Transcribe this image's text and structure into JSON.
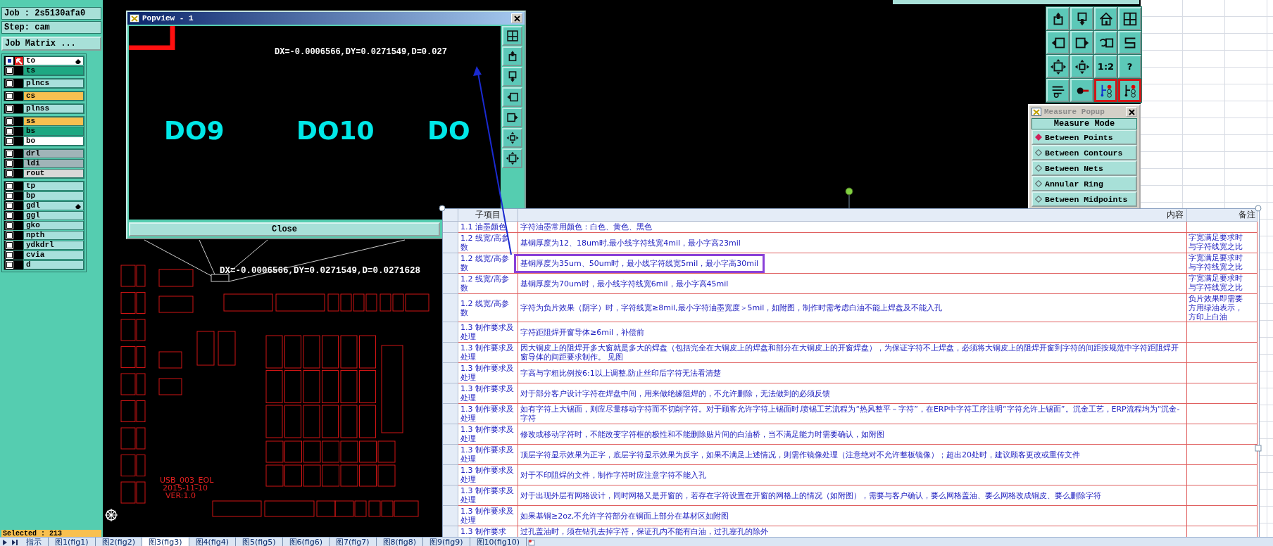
{
  "job_panel": {
    "job": "Job : 2s5130afa0",
    "step": "Step: cam",
    "matrix_button": "Job Matrix ...",
    "layer_groups": [
      {
        "layers": [
          {
            "name": "to",
            "color": "#ffffff",
            "checked": true,
            "work": true,
            "pointer": true
          },
          {
            "name": "ts",
            "color": "#1ea882",
            "checked": false,
            "work": false,
            "pointer": false
          }
        ]
      },
      {
        "layers": [
          {
            "name": "plncs",
            "color": "#a8e0dc",
            "checked": false,
            "work": false,
            "pointer": false
          }
        ]
      },
      {
        "layers": [
          {
            "name": "cs",
            "color": "#f8c050",
            "checked": false,
            "work": false,
            "pointer": false
          }
        ]
      },
      {
        "layers": [
          {
            "name": "plnss",
            "color": "#a8e0dc",
            "checked": false,
            "work": false,
            "pointer": false
          }
        ]
      },
      {
        "layers": [
          {
            "name": "ss",
            "color": "#f8c050",
            "checked": false,
            "work": false,
            "pointer": false
          },
          {
            "name": "bs",
            "color": "#1ea882",
            "checked": false,
            "work": false,
            "pointer": false
          },
          {
            "name": "bo",
            "color": "#ffffff",
            "checked": false,
            "work": false,
            "pointer": false
          }
        ]
      },
      {
        "layers": [
          {
            "name": "drl",
            "color": "#a0b4b8",
            "checked": false,
            "work": false,
            "pointer": false
          },
          {
            "name": "ldi",
            "color": "#a0b4b8",
            "checked": false,
            "work": false,
            "pointer": false
          },
          {
            "name": "rout",
            "color": "#d8d8d8",
            "checked": false,
            "work": false,
            "pointer": false
          }
        ]
      },
      {
        "layers": [
          {
            "name": "tp",
            "color": "#a8e0dc",
            "checked": false,
            "work": false,
            "pointer": false
          },
          {
            "name": "bp",
            "color": "#a8e0dc",
            "checked": false,
            "work": false,
            "pointer": false
          },
          {
            "name": "gdl",
            "color": "#a8e0dc",
            "checked": false,
            "work": false,
            "pointer": true
          },
          {
            "name": "ggl",
            "color": "#a8e0dc",
            "checked": false,
            "work": false,
            "pointer": false
          },
          {
            "name": "gko",
            "color": "#a8e0dc",
            "checked": false,
            "work": false,
            "pointer": false
          },
          {
            "name": "npth",
            "color": "#a8e0dc",
            "checked": false,
            "work": false,
            "pointer": false
          },
          {
            "name": "ydkdrl",
            "color": "#a8e0dc",
            "checked": false,
            "work": false,
            "pointer": false
          },
          {
            "name": "cvia",
            "color": "#a8e0dc",
            "checked": false,
            "work": false,
            "pointer": false
          },
          {
            "name": "d",
            "color": "#a8e0dc",
            "checked": false,
            "work": false,
            "pointer": false
          }
        ]
      }
    ],
    "selected_count": "Selected : 213"
  },
  "canvas": {
    "measurement": "DX=-0.0006566,DY=0.0271549,D=0.0271628",
    "board_labels": [
      "USB_003_EOL",
      "2015-11-10",
      "VER:1.0"
    ]
  },
  "popview": {
    "title": "Popview - 1",
    "measurement": "DX=-0.0006566,DY=0.0271549,D=0.027",
    "labels": [
      "DO9",
      "DO10",
      "DO"
    ],
    "close_button": "Close"
  },
  "toolbar": {
    "buttons": [
      {
        "kind": "icon",
        "selected": false
      },
      {
        "kind": "icon",
        "selected": false
      },
      {
        "kind": "icon",
        "selected": false
      },
      {
        "kind": "icon",
        "selected": false
      },
      {
        "kind": "icon",
        "selected": false
      },
      {
        "kind": "icon",
        "selected": false
      },
      {
        "kind": "icon",
        "selected": false
      },
      {
        "kind": "icon",
        "selected": false
      },
      {
        "kind": "icon",
        "selected": false
      },
      {
        "kind": "icon",
        "selected": false
      },
      {
        "kind": "text",
        "label": "1:2",
        "selected": false
      },
      {
        "kind": "text",
        "label": "?",
        "selected": false
      },
      {
        "kind": "icon",
        "selected": false
      },
      {
        "kind": "icon",
        "selected": false
      },
      {
        "kind": "icon",
        "selected": true
      },
      {
        "kind": "icon",
        "selected": true
      }
    ]
  },
  "measure_popup": {
    "title": "Measure Popup",
    "heading": "Measure Mode",
    "modes": [
      {
        "label": "Between Points",
        "selected": true
      },
      {
        "label": "Between Contours",
        "selected": false
      },
      {
        "label": "Between Nets",
        "selected": false
      },
      {
        "label": "Annular Ring",
        "selected": false
      },
      {
        "label": "Between Midpoints",
        "selected": false
      }
    ]
  },
  "sheet": {
    "columns": [
      "子项目",
      "内容",
      "备注"
    ],
    "rows": [
      {
        "item": "1.1 油墨颜色",
        "content": "字符油墨常用颜色：白色、黄色、黑色",
        "note": [],
        "highlighted": false
      },
      {
        "item": "1.2 线宽/高参数",
        "content": "基铜厚度为12、18um时,最小线字符线宽4mil，最小字高23mil",
        "note": [
          "字宽满足要求时",
          "与字符线宽之比"
        ],
        "highlighted": false
      },
      {
        "item": "1.2 线宽/高参数",
        "content": "基铜厚度为35um、50um时，最小线字符线宽5mil，最小字高30mil",
        "note": [
          "字宽满足要求时",
          "与字符线宽之比"
        ],
        "highlighted": true
      },
      {
        "item": "1.2 线宽/高参数",
        "content": "基铜厚度为70um时，最小线字符线宽6mil，最小字高45mil",
        "note": [
          "字宽满足要求时",
          "与字符线宽之比"
        ],
        "highlighted": false
      },
      {
        "item": "1.2 线宽/高参数",
        "content": "字符为负片效果（阴字）时，字符线宽≥8mil,最小字符油墨宽度＞5mil，如附图，制作时需考虑白油不能上焊盘及不能入孔",
        "note": [
          "负片效果即需要",
          "方用绿油表示，",
          "方印上白油"
        ],
        "highlighted": false
      },
      {
        "item": "1.3 制作要求及处理",
        "content": "字符距阻焊开窗导体≥6mil，补偿前",
        "note": [],
        "highlighted": false
      },
      {
        "item": "1.3 制作要求及处理",
        "content": "因大铜皮上的阻焊开多大窗就是多大的焊盘（包括完全在大铜皮上的焊盘和部分在大铜皮上的开窗焊盘），为保证字符不上焊盘，必须将大铜皮上的阻焊开窗到字符的间距按规范中字符距阻焊开窗导体的间距要求制作。 见图",
        "note": [],
        "highlighted": false
      },
      {
        "item": "1.3 制作要求及处理",
        "content": "字高与字粗比例按6:1以上调整,防止丝印后字符无法看清楚",
        "note": [],
        "highlighted": false
      },
      {
        "item": "1.3 制作要求及处理",
        "content": "对于部分客户设计字符在焊盘中间，用来做绝缘阻焊的，不允许删除，无法做到的必须反馈",
        "note": [],
        "highlighted": false
      },
      {
        "item": "1.3 制作要求及处理",
        "content": "如有字符上大锡面，则应尽量移动字符而不切削字符。对于顾客允许字符上锡面时,喷锡工艺流程为“热风整平－字符”，在ERP中字符工序注明“字符允许上锡面”。沉金工艺，ERP流程均为“沉金-字符",
        "note": [],
        "highlighted": false
      },
      {
        "item": "1.3 制作要求及处理",
        "content": "修改或移动字符时，不能改变字符框的极性和不能删除贴片间的白油桥，当不满足能力时需要确认，如附图",
        "note": [],
        "highlighted": false
      },
      {
        "item": "1.3 制作要求及处理",
        "content": "顶层字符显示效果为正字，底层字符显示效果为反字，如果不满足上述情况，则需作镜像处理（注意绝对不允许整板镜像）；超出20处时，建议顾客更改或重传文件",
        "note": [],
        "highlighted": false
      },
      {
        "item": "1.3 制作要求及处理",
        "content": "对于不印阻焊的文件，制作字符时应注意字符不能入孔",
        "note": [],
        "highlighted": false
      },
      {
        "item": "1.3 制作要求及处理",
        "content": "对于出现外层有网格设计，同时网格又是开窗的，若存在字符设置在开窗的网格上的情况（如附图），需要与客户确认，要么网格盖油、要么网格改成铜皮、要么删除字符",
        "note": [],
        "highlighted": false
      },
      {
        "item": "1.3 制作要求及处理",
        "content": "如果基铜≥2oz,不允许字符部分在铜面上部分在基材区如附图",
        "note": [],
        "highlighted": false
      },
      {
        "item": "1.3 制作要求",
        "content": "过孔盖油时，须在钻孔去掉字符，保证孔内不能有白油，过孔塞孔的除外",
        "note": [],
        "highlighted": false
      }
    ]
  },
  "sheet_tabs": [
    {
      "label": "指示",
      "selected": false
    },
    {
      "label": "图1(fig1)",
      "selected": false
    },
    {
      "label": "图2(fig2)",
      "selected": false
    },
    {
      "label": "图3(fig3)",
      "selected": true
    },
    {
      "label": "图4(fig4)",
      "selected": false
    },
    {
      "label": "图5(fig5)",
      "selected": false
    },
    {
      "label": "图6(fig6)",
      "selected": false
    },
    {
      "label": "图7(fig7)",
      "selected": false
    },
    {
      "label": "图8(fig8)",
      "selected": false
    },
    {
      "label": "图9(fig9)",
      "selected": false
    },
    {
      "label": "图10(fig10)",
      "selected": false
    }
  ]
}
